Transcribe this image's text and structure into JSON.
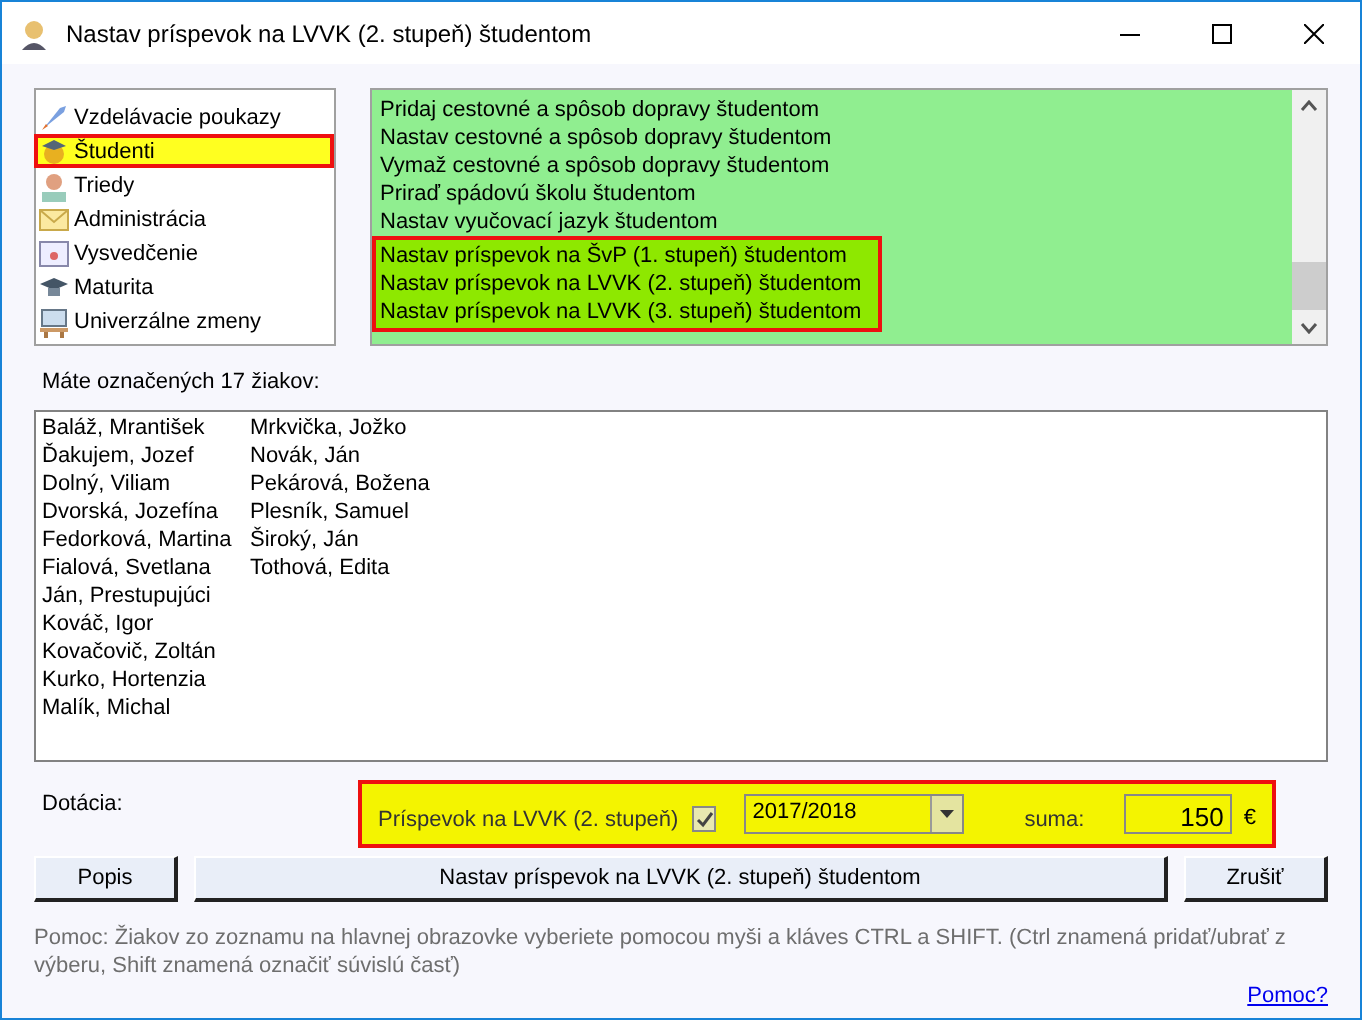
{
  "window": {
    "title": "Nastav príspevok na LVVK (2. stupeň) študentom"
  },
  "nav": {
    "items": [
      {
        "label": "Vzdelávacie poukazy",
        "selected": false
      },
      {
        "label": "Študenti",
        "selected": true
      },
      {
        "label": "Triedy",
        "selected": false
      },
      {
        "label": "Administrácia",
        "selected": false
      },
      {
        "label": "Vysvedčenie",
        "selected": false
      },
      {
        "label": "Maturita",
        "selected": false
      },
      {
        "label": "Univerzálne zmeny",
        "selected": false
      }
    ]
  },
  "actions": {
    "items": [
      {
        "label": "Pridaj cestovné a spôsob dopravy študentom",
        "highlighted": false
      },
      {
        "label": "Nastav cestovné a spôsob dopravy študentom",
        "highlighted": false
      },
      {
        "label": "Vymaž cestovné a spôsob dopravy študentom",
        "highlighted": false
      },
      {
        "label": "Priraď spádovú školu študentom",
        "highlighted": false
      },
      {
        "label": "Nastav vyučovací jazyk študentom",
        "highlighted": false
      },
      {
        "label": "Nastav príspevok na ŠvP (1. stupeň) študentom",
        "highlighted": true
      },
      {
        "label": "Nastav príspevok na LVVK (2. stupeň) študentom",
        "highlighted": true
      },
      {
        "label": "Nastav príspevok na LVVK (3. stupeň) študentom",
        "highlighted": true
      }
    ]
  },
  "count_label": "Máte označených 17 žiakov:",
  "students": {
    "columns": [
      [
        "Baláž, Mrantišek",
        "Ďakujem, Jozef",
        "Dolný, Viliam",
        "Dvorská, Jozefína",
        "Fedorková, Martina",
        "Fialová, Svetlana",
        "Ján, Prestupujúci",
        "Kováč, Igor",
        "Kovačovič, Zoltán",
        "Kurko, Hortenzia",
        "Malík, Michal"
      ],
      [
        "Mrkvička, Jožko",
        "Novák, Ján",
        "Pekárová, Božena",
        "Plesník, Samuel",
        "Široký, Ján",
        "Tothová, Edita"
      ]
    ]
  },
  "subsidy": {
    "label": "Dotácia:",
    "checkbox_label": "Príspevok na LVVK (2. stupeň)",
    "checked": true,
    "year": "2017/2018",
    "sum_label": "suma:",
    "sum": "150",
    "currency": "€"
  },
  "buttons": [
    {
      "label": "Popis",
      "kind": "small"
    },
    {
      "label": "Nastav príspevok na LVVK (2. stupeň) študentom",
      "kind": "wide"
    },
    {
      "label": "Zrušiť",
      "kind": "small"
    }
  ],
  "help": {
    "text": "Pomoc: Žiakov zo zoznamu na hlavnej obrazovke vyberiete pomocou myši a kláves CTRL a SHIFT. (Ctrl znamená pridať/ubrať z výberu, Shift znamená označiť súvislú časť)",
    "link": "Pomoc?"
  }
}
